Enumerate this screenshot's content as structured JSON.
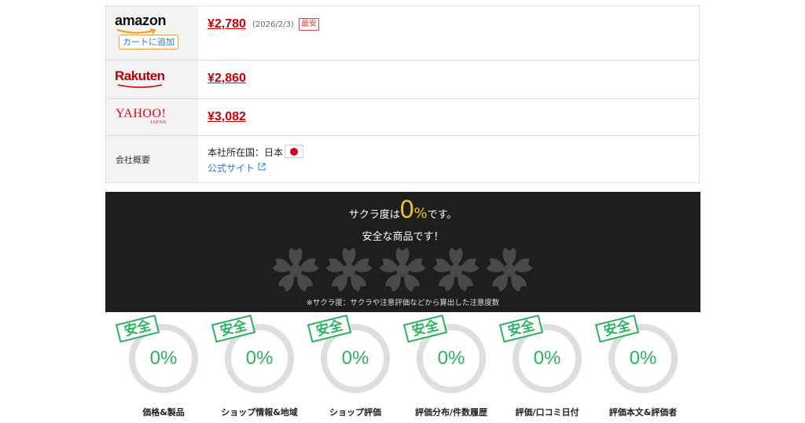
{
  "shops": {
    "amazon": {
      "logo": "amazon",
      "cart_button": "カートに追加",
      "price": "¥2,780",
      "date": "(2026/2/3)",
      "badge": "最安"
    },
    "rakuten": {
      "logo": "Rakuten",
      "price": "¥2,860"
    },
    "yahoo": {
      "logo": "YAHOO!",
      "logo_sub": "JAPAN",
      "price": "¥3,082"
    }
  },
  "company": {
    "label": "会社概要",
    "hq": "本社所在国：日本",
    "flag_icon": "japan-flag-icon",
    "site_link": "公式サイト"
  },
  "sakura": {
    "prefix": "サクラ度は",
    "percent": "0",
    "unit": "%",
    "suffix": "です。",
    "verdict": "安全な商品です！",
    "note": "※サクラ度：サクラや注意評価などから算出した注意度数",
    "colors": {
      "panel_bg": "#1e1e1e",
      "highlight": "#f2c52b",
      "flower": "#4a4a4a"
    }
  },
  "metrics": [
    {
      "stamp": "安全",
      "value": "0%",
      "label": "価格&製品"
    },
    {
      "stamp": "安全",
      "value": "0%",
      "label": "ショップ情報&地域"
    },
    {
      "stamp": "安全",
      "value": "0%",
      "label": "ショップ評価"
    },
    {
      "stamp": "安全",
      "value": "0%",
      "label": "評価分布/件数履歴"
    },
    {
      "stamp": "安全",
      "value": "0%",
      "label": "評価/口コミ日付"
    },
    {
      "stamp": "安全",
      "value": "0%",
      "label": "評価本文&評価者"
    }
  ],
  "colors": {
    "price": "#cc0000",
    "safe_green": "#2bb15f",
    "link": "#2b7bd6"
  }
}
